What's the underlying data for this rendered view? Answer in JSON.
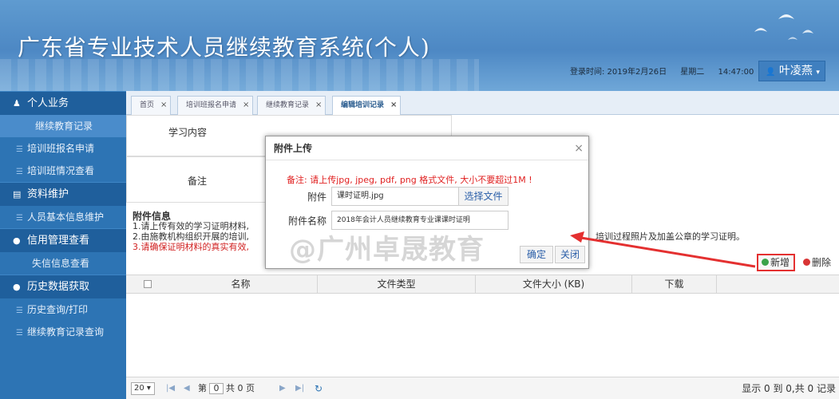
{
  "header": {
    "title": "广东省专业技术人员继续教育系统(个人)",
    "login_label": "登录时间: 2019年2月26日",
    "weekday": "星期二",
    "time": "14:47:00",
    "user_name": "叶凌燕"
  },
  "sidebar": {
    "groups": [
      {
        "label": "个人业务",
        "icon": "user-icon"
      },
      {
        "label": "资料维护",
        "icon": "book-icon"
      },
      {
        "label": "信用管理查看",
        "icon": "pin-icon"
      },
      {
        "label": "历史数据获取",
        "icon": "pin-icon"
      }
    ],
    "items": {
      "continuing_records": "继续教育记录",
      "training_apply": "培训班报名申请",
      "training_status": "培训班情况查看",
      "basic_info": "人员基本信息维护",
      "dishonesty": "失信信息查看",
      "history_print": "历史查询/打印",
      "record_query": "继续教育记录查询"
    }
  },
  "tabs": [
    {
      "label": "首页"
    },
    {
      "label": "培训班报名申请"
    },
    {
      "label": "继续教育记录"
    },
    {
      "label": "编辑培训记录"
    }
  ],
  "form": {
    "study_content_label": "学习内容",
    "remark_label": "备注"
  },
  "attachments": {
    "heading": "附件信息",
    "note1": "1.请上传有效的学习证明材料,",
    "note2": "2.由施教机构组织开展的培训,",
    "note3": "3.请确保证明材料的真实有效,",
    "note2_tail": "培训过程照片及加盖公章的学习证明。",
    "add_label": "新增",
    "delete_label": "删除",
    "columns": [
      "名称",
      "文件类型",
      "文件大小 (KB)",
      "下载"
    ]
  },
  "pager": {
    "page_size": "20",
    "page_prefix": "第",
    "page_value": "0",
    "page_suffix": "共 0 页",
    "summary": "显示 0 到 0,共 0 记录"
  },
  "modal": {
    "title": "附件上传",
    "warning": "备注: 请上传jpg, jpeg, pdf, png 格式文件, 大小不要超过1M !",
    "file_label": "附件",
    "file_value": "课时证明.jpg",
    "choose_label": "选择文件",
    "name_label": "附件名称",
    "name_value": "2018年会计人员继续教育专业课课时证明",
    "confirm_label": "确定",
    "close_label": "关闭"
  },
  "watermark": "@广州卓晟教育",
  "colors": {
    "header_blue": "#4d88c4",
    "sidebar_blue": "#2d74b4",
    "warning_red": "#e02020",
    "highlight_red": "#e43030"
  }
}
